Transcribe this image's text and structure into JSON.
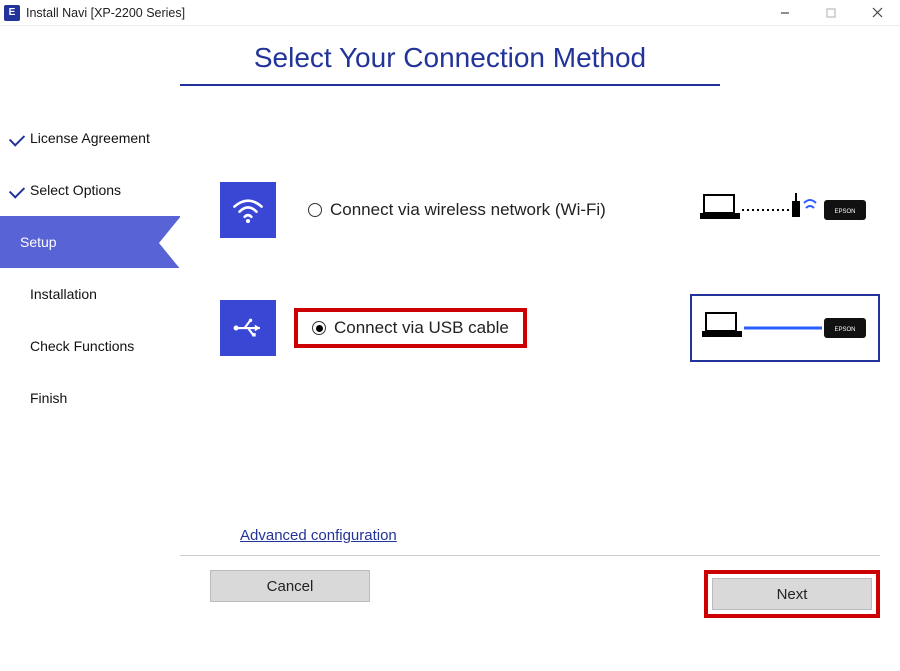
{
  "titlebar": {
    "app_letter": "E",
    "title": "Install Navi [XP-2200 Series]"
  },
  "page": {
    "title": "Select Your Connection Method"
  },
  "sidebar": {
    "steps": [
      {
        "label": "License Agreement",
        "state": "completed"
      },
      {
        "label": "Select Options",
        "state": "completed"
      },
      {
        "label": "Setup",
        "state": "active"
      },
      {
        "label": "Installation",
        "state": "pending"
      },
      {
        "label": "Check Functions",
        "state": "pending"
      },
      {
        "label": "Finish",
        "state": "pending"
      }
    ]
  },
  "options": {
    "wifi": {
      "label": "Connect via wireless network (Wi-Fi)",
      "selected": false
    },
    "usb": {
      "label": "Connect via USB cable",
      "selected": true
    }
  },
  "links": {
    "advanced": "Advanced configuration"
  },
  "buttons": {
    "cancel": "Cancel",
    "next": "Next"
  }
}
